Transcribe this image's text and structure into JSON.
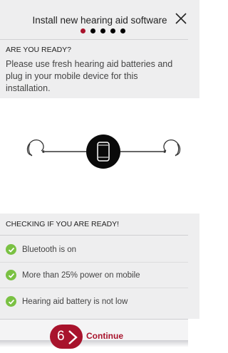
{
  "header": {
    "title": "Install new hearing aid software",
    "step_dots": 5,
    "active_dot": 0
  },
  "ready": {
    "heading": "ARE YOU READY?",
    "text": "Please use fresh hearing aid batteries and plug in your mobile device for this installation."
  },
  "diagram": {
    "left_icon": "hearing-aid-icon",
    "center_icon": "smartphone-icon",
    "right_icon": "hearing-aid-icon"
  },
  "checks": {
    "heading": "CHECKING IF YOU ARE READY!",
    "items": [
      {
        "label": "Bluetooth is on",
        "status": "ok"
      },
      {
        "label": "More than 25% power on mobile",
        "status": "ok"
      },
      {
        "label": "Hearing aid battery is not low",
        "status": "ok"
      }
    ]
  },
  "footer": {
    "continue_label": "Continue",
    "step_number": "6"
  },
  "colors": {
    "accent": "#a8132c",
    "success": "#7ac143",
    "panel": "#eeeeef"
  }
}
